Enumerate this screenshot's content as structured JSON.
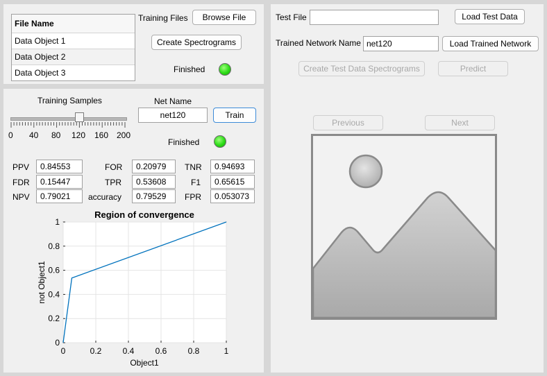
{
  "files_table": {
    "header": "File Name",
    "rows": [
      "Data Object 1",
      "Data Object 2",
      "Data Object 3"
    ]
  },
  "training_files": {
    "label": "Training Files",
    "browse_label": "Browse File",
    "create_label": "Create Spectrograms",
    "status": "Finished",
    "lamp_color": "#2bdc16"
  },
  "training": {
    "slider_label": "Training Samples",
    "slider_value": 120,
    "slider_ticks": [
      "0",
      "40",
      "80",
      "120",
      "160",
      "200"
    ],
    "net_name_label": "Net Name",
    "net_name_value": "net120",
    "train_label": "Train",
    "status": "Finished",
    "lamp_color": "#2bdc16"
  },
  "metrics": {
    "ppv_label": "PPV",
    "ppv": "0.84553",
    "fdr_label": "FDR",
    "fdr": "0.15447",
    "npv_label": "NPV",
    "npv": "0.79021",
    "for_label": "FOR",
    "for": "0.20979",
    "tpr_label": "TPR",
    "tpr": "0.53608",
    "accuracy_label": "accuracy",
    "accuracy": "0.79529",
    "tnr_label": "TNR",
    "tnr": "0.94693",
    "f1_label": "F1",
    "f1": "0.65615",
    "fpr_label": "FPR",
    "fpr": "0.053073"
  },
  "chart_data": {
    "type": "line",
    "title": "Region of convergence",
    "xlabel": "Object1",
    "ylabel": "not Object1",
    "xlim": [
      0,
      1
    ],
    "ylim": [
      0,
      1
    ],
    "xticks": [
      "0",
      "0.2",
      "0.4",
      "0.6",
      "0.8",
      "1"
    ],
    "yticks": [
      "0",
      "0.2",
      "0.4",
      "0.6",
      "0.8",
      "1"
    ],
    "grid": true,
    "series": [
      {
        "x": [
          0,
          0.053,
          1
        ],
        "y": [
          0,
          0.536,
          1
        ],
        "color": "#0072bd"
      }
    ]
  },
  "test": {
    "test_file_label": "Test File",
    "test_file_value": "",
    "load_test_label": "Load Test Data",
    "trained_net_label": "Trained Network Name",
    "trained_net_value": "net120",
    "load_trained_label": "Load Trained Network",
    "create_test_label": "Create Test Data Spectrograms",
    "predict_label": "Predict",
    "previous_label": "Previous",
    "next_label": "Next",
    "placeholder_icon": "image-placeholder-icon"
  }
}
